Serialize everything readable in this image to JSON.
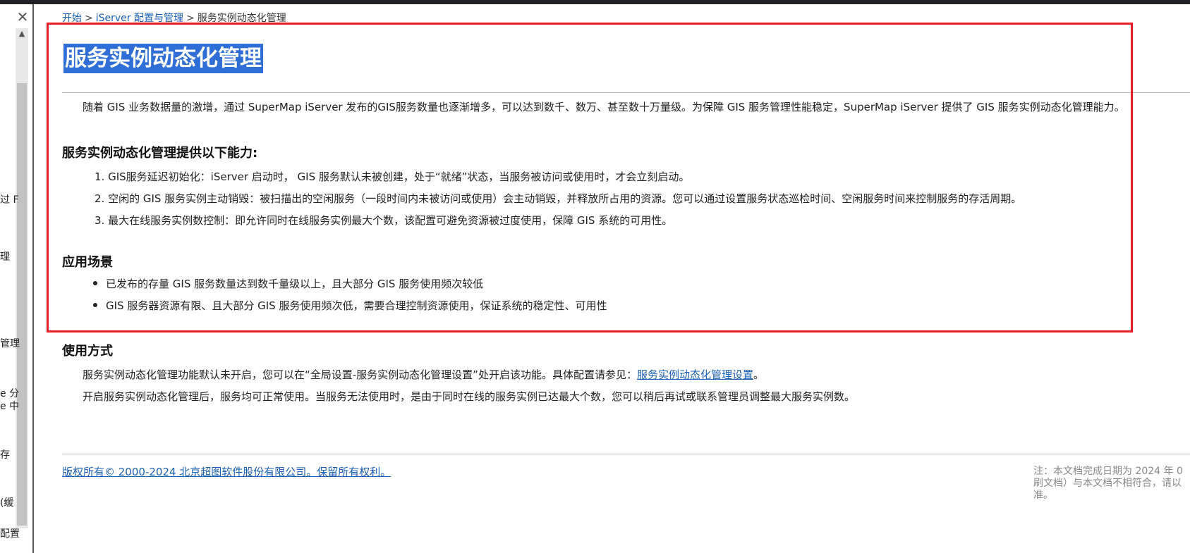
{
  "sidebar": {
    "close_glyph": "✕",
    "scroll_up_glyph": "▲",
    "fragments": [
      "过 F",
      "理",
      "管理",
      "e 分",
      "e 中",
      "存",
      "(缓",
      "配置"
    ]
  },
  "breadcrumb": {
    "items": [
      "开始",
      "iServer 配置与管理",
      "服务实例动态化管理"
    ],
    "separator": ">"
  },
  "article": {
    "title": "服务实例动态化管理",
    "intro": "随着 GIS 业务数据量的激增，通过 SuperMap iServer 发布的GIS服务数量也逐渐增多，可以达到数千、数万、甚至数十万量级。为保障 GIS 服务管理性能稳定，SuperMap iServer 提供了 GIS 服务实例动态化管理能力。",
    "capabilities_heading": "服务实例动态化管理提供以下能力:",
    "capabilities": [
      "1. GIS服务延迟初始化：iServer 启动时， GIS 服务默认未被创建，处于“就绪”状态，当服务被访问或使用时，才会立刻启动。",
      "2. 空闲的 GIS 服务实例主动销毁：被扫描出的空闲服务（一段时间内未被访问或使用）会主动销毁，并释放所占用的资源。您可以通过设置服务状态巡检时间、空闲服务时间来控制服务的存活周期。",
      "3. 最大在线服务实例数控制：即允许同时在线服务实例最大个数，该配置可避免资源被过度使用，保障 GIS 系统的可用性。"
    ],
    "scenarios_heading": "应用场景",
    "scenarios": [
      "已发布的存量 GIS 服务数量达到数千量级以上，且大部分 GIS 服务使用频次较低",
      "GIS 服务器资源有限、且大部分 GIS 服务使用频次低，需要合理控制资源使用，保证系统的稳定性、可用性"
    ],
    "usage_heading": "使用方式",
    "usage_line1_prefix": "服务实例动态化管理功能默认未开启，您可以在“全局设置-服务实例动态化管理设置”处开启该功能。具体配置请参见：",
    "usage_line1_link": "服务实例动态化管理设置",
    "usage_line1_suffix": "。",
    "usage_line2": "开启服务实例动态化管理后，服务均可正常使用。当服务无法使用时，是由于同时在线的服务实例已达最大个数，您可以稍后再试或联系管理员调整最大服务实例数。"
  },
  "footer": {
    "copyright": "版权所有© 2000-2024 北京超图软件股份有限公司。保留所有权利。",
    "note_lines": [
      "注：本文档完成日期为 2024 年 0",
      "刷文档）与本文档不相符合，请以",
      "准。"
    ]
  },
  "colors": {
    "highlight_border": "#ea1c24",
    "title_selection": "#2f6ed6",
    "link": "#1a5fb4"
  }
}
